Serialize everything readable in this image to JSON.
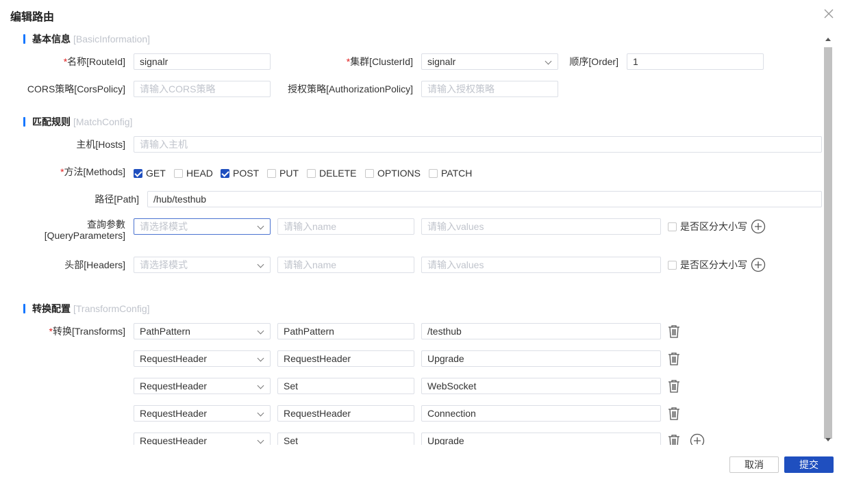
{
  "dialog": {
    "title": "编辑路由",
    "cancel_label": "取消",
    "submit_label": "提交"
  },
  "basic": {
    "title": "基本信息",
    "subtitle": "[BasicInformation]",
    "route_id_label": "名称[RouteId]",
    "route_id_value": "signalr",
    "cluster_id_label": "集群[ClusterId]",
    "cluster_id_value": "signalr",
    "order_label": "顺序[Order]",
    "order_value": "1",
    "cors_label": "CORS策略[CorsPolicy]",
    "cors_placeholder": "请输入CORS策略",
    "auth_label": "授权策略[AuthorizationPolicy]",
    "auth_placeholder": "请输入授权策略"
  },
  "match": {
    "title": "匹配规则",
    "subtitle": "[MatchConfig]",
    "hosts_label": "主机[Hosts]",
    "hosts_placeholder": "请输入主机",
    "methods_label": "方法[Methods]",
    "methods": [
      {
        "label": "GET",
        "checked": true
      },
      {
        "label": "HEAD",
        "checked": false
      },
      {
        "label": "POST",
        "checked": true
      },
      {
        "label": "PUT",
        "checked": false
      },
      {
        "label": "DELETE",
        "checked": false
      },
      {
        "label": "OPTIONS",
        "checked": false
      },
      {
        "label": "PATCH",
        "checked": false
      }
    ],
    "path_label": "路径[Path]",
    "path_value": "/hub/testhub",
    "query_label_1": "查詢参數",
    "query_label_2": "[QueryParameters]",
    "mode_placeholder": "请选择模式",
    "name_placeholder": "请输入name",
    "values_placeholder": "请输入values",
    "case_label": "是否区分大小写",
    "headers_label": "头部[Headers]"
  },
  "transform": {
    "title": "转换配置",
    "subtitle": "[TransformConfig]",
    "label": "转换[Transforms]",
    "rows": [
      {
        "type": "PathPattern",
        "key": "PathPattern",
        "value": "/testhub"
      },
      {
        "type": "RequestHeader",
        "key": "RequestHeader",
        "value": "Upgrade"
      },
      {
        "type": "RequestHeader",
        "key": "Set",
        "value": "WebSocket"
      },
      {
        "type": "RequestHeader",
        "key": "RequestHeader",
        "value": "Connection"
      },
      {
        "type": "RequestHeader",
        "key": "Set",
        "value": "Upgrade"
      }
    ]
  }
}
